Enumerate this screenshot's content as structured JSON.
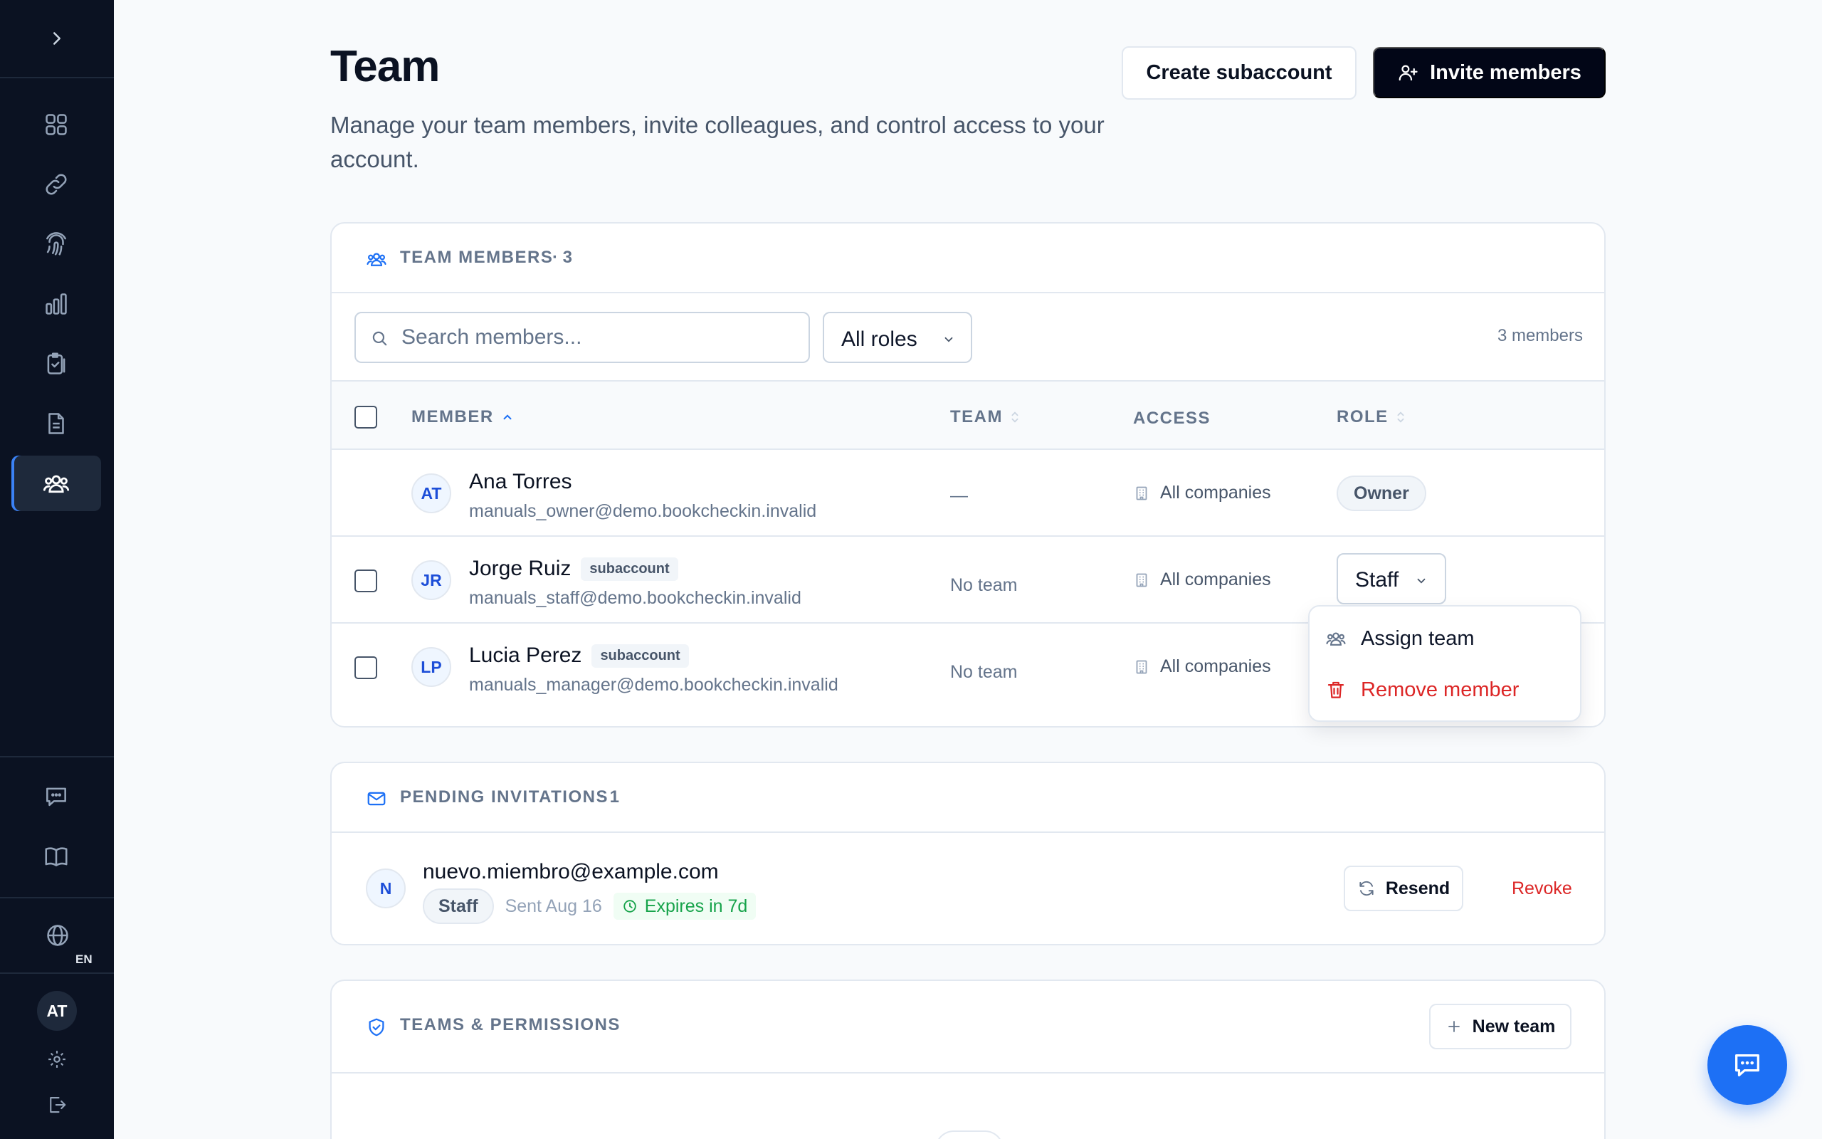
{
  "sidebar": {
    "toggle_icon": "chevron-right-icon",
    "nav_items": [
      {
        "icon": "grid-icon",
        "active": false
      },
      {
        "icon": "link-icon",
        "active": false
      },
      {
        "icon": "fingerprint-icon",
        "active": false
      },
      {
        "icon": "bar-chart-icon",
        "active": false
      },
      {
        "icon": "clipboard-check-icon",
        "active": false
      },
      {
        "icon": "document-icon",
        "active": false
      },
      {
        "icon": "team-icon",
        "active": true
      }
    ],
    "bottom_items": [
      {
        "icon": "chat-icon"
      },
      {
        "icon": "book-icon"
      }
    ],
    "language": {
      "icon": "globe-icon",
      "code": "EN"
    },
    "user_initials": "AT",
    "settings_icon": "gear-icon",
    "logout_icon": "logout-icon"
  },
  "header": {
    "title": "Team",
    "subtitle": "Manage your team members, invite colleagues, and control access to your account.",
    "create_subaccount_label": "Create subaccount",
    "invite_members_label": "Invite members"
  },
  "members_card": {
    "label": "TEAM MEMBERS",
    "count": "· 3",
    "search_placeholder": "Search members...",
    "role_filter": "All roles",
    "members_count": "3 members",
    "columns": {
      "member": "MEMBER",
      "team": "TEAM",
      "access": "ACCESS",
      "role": "ROLE"
    },
    "rows": [
      {
        "initials": "AT",
        "name": "Ana Torres",
        "badge": "",
        "email": "manuals_owner@demo.bookcheckin.invalid",
        "team": "—",
        "access": "All companies",
        "role": "Owner"
      },
      {
        "initials": "JR",
        "name": "Jorge Ruiz",
        "badge": "subaccount",
        "email": "manuals_staff@demo.bookcheckin.invalid",
        "team": "No team",
        "access": "All companies",
        "role": "Staff"
      },
      {
        "initials": "LP",
        "name": "Lucia Perez",
        "badge": "subaccount",
        "email": "manuals_manager@demo.bookcheckin.invalid",
        "team": "No team",
        "access": "All companies",
        "role": ""
      }
    ],
    "menu": {
      "assign_team": "Assign team",
      "remove_member": "Remove member"
    }
  },
  "invitations_card": {
    "label": "PENDING INVITATIONS",
    "count": "· 1",
    "items": [
      {
        "initial": "N",
        "email": "nuevo.miembro@example.com",
        "role": "Staff",
        "sent": "Sent Aug 16",
        "expires": "Expires in 7d",
        "resend_label": "Resend",
        "revoke_label": "Revoke"
      }
    ]
  },
  "teams_card": {
    "label": "TEAMS & PERMISSIONS",
    "new_team_label": "New team"
  },
  "colors": {
    "sidebar_bg": "#0b1222",
    "primary_dark": "#020617",
    "accent_blue": "#1d70f5",
    "danger": "#dc2626",
    "success": "#16a34a"
  }
}
